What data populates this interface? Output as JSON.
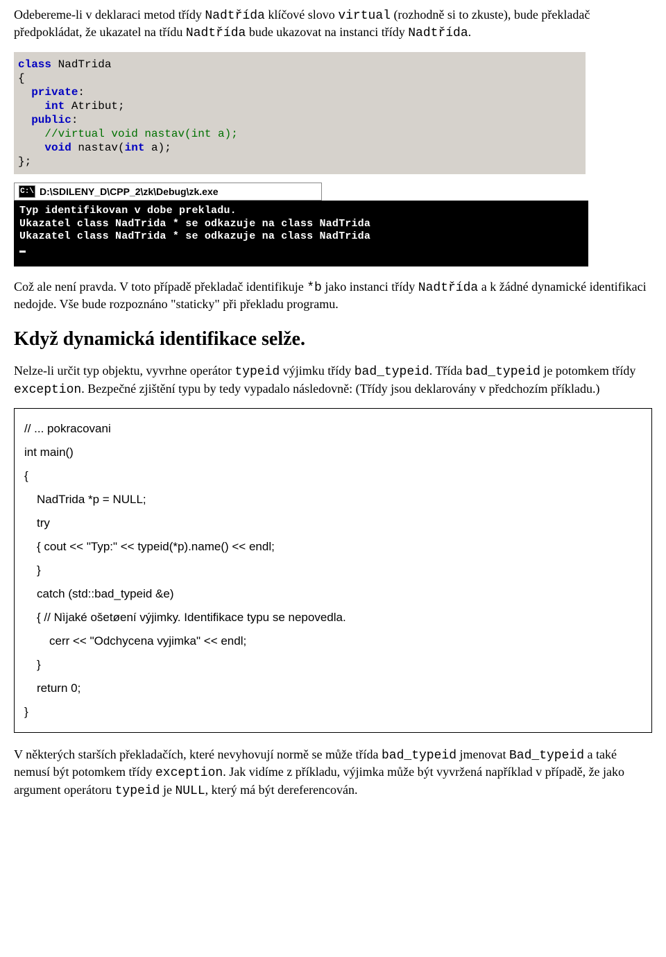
{
  "para1_a": "Odebereme-li v deklaraci metod třídy ",
  "para1_b": " klíčové slovo ",
  "para1_c": " (rozhodně si to zkuste), bude překladač předpokládat, že ukazatel na třídu ",
  "para1_d": " bude ukazovat na instanci třídy ",
  "para1_e": ".",
  "ct_Nadtrida": "Nadtřída",
  "ct_virtual": "virtual",
  "ide": {
    "l1a": "class",
    "l1b": " NadTrida",
    "l2": "{",
    "l3a": "private",
    "l3b": ":",
    "l4a": "int",
    "l4b": " Atribut;",
    "l5a": "public",
    "l5b": ":",
    "l6": "//virtual void nastav(int a);",
    "l7a": "void",
    "l7b": " nastav(",
    "l7c": "int",
    "l7d": " a);",
    "l8": "};"
  },
  "console": {
    "title": "D:\\SDILENY_D\\CPP_2\\zk\\Debug\\zk.exe",
    "l1": "Typ identifikovan v dobe prekladu.",
    "l2": "Ukazatel class NadTrida * se odkazuje na class NadTrida",
    "l3": "Ukazatel class NadTrida * se odkazuje na class NadTrida"
  },
  "para2_a": "Což ale není pravda. V toto případě překladač identifikuje ",
  "para2_b": " jako instanci třídy ",
  "para2_c": " a k žádné dynamické identifikaci nedojde. Vše bude rozpoznáno \"staticky\" při překladu programu.",
  "ct_starb": "*b",
  "heading": "Když dynamická identifikace selže.",
  "para3_a": "Nelze-li určit typ objektu, vyvrhne operátor ",
  "para3_b": " výjimku třídy ",
  "para3_c": ". Třída ",
  "para3_d": " je potomkem třídy ",
  "para3_e": ". Bezpečné zjištění typu by tedy vypadalo následovně: (Třídy jsou deklarovány v předchozím příkladu.)",
  "ct_typeid": "typeid",
  "ct_bad_typeid": "bad_typeid",
  "ct_exception": "exception",
  "code": {
    "l1": "// ... pokracovani",
    "l2": "int main()",
    "l3": "{",
    "l4": "NadTrida *p = NULL;",
    "l5": "try",
    "l6": "{ cout << \"Typ:\" << typeid(*p).name() << endl;",
    "l7": "}",
    "l8": "catch (std::bad_typeid &e)",
    "l9": "{ // Nìjaké ošetøení výjimky. Identifikace typu se nepovedla.",
    "l10": "cerr << \"Odchycena vyjimka\" << endl;",
    "l11": "}",
    "l12": "return 0;",
    "l13": "}"
  },
  "para4_a": "V některých starších překladačích, které nevyhovují normě se může třída ",
  "para4_b": " jmenovat ",
  "para4_c": " a také nemusí být potomkem třídy ",
  "para4_d": ". Jak vidíme z příkladu, výjimka může být vyvržená například v případě, že jako argument operátoru ",
  "para4_e": " je ",
  "para4_f": ", který má být dereferencován.",
  "ct_Bad_typeid": "Bad_typeid",
  "ct_NULL": "NULL"
}
